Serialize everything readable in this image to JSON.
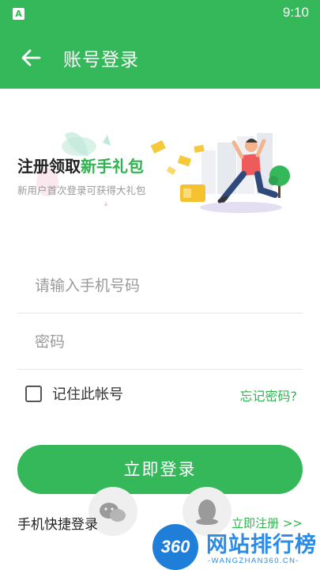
{
  "status_bar": {
    "time": "9:10",
    "app_icon_letter": "A"
  },
  "app_bar": {
    "title": "账号登录"
  },
  "banner": {
    "headline_prefix": "注册领取",
    "headline_highlight": "新手礼包",
    "subtitle": "新用户首次登录可获得大礼包"
  },
  "form": {
    "phone_placeholder": "请输入手机号码",
    "password_placeholder": "密码",
    "remember_label": "记住此帐号",
    "forgot_label": "忘记密码?",
    "login_label": "立即登录"
  },
  "footer": {
    "quick_login_label": "手机快捷登录",
    "register_label": "立即注册 >>"
  },
  "watermark": {
    "logo_text": "360",
    "brand_text": "网站排行榜",
    "domain_text": "-WANGZHAN360.CN-"
  },
  "colors": {
    "primary": "#34b85a",
    "accent_text": "#2fb34f",
    "watermark": "#2a8ce8"
  }
}
